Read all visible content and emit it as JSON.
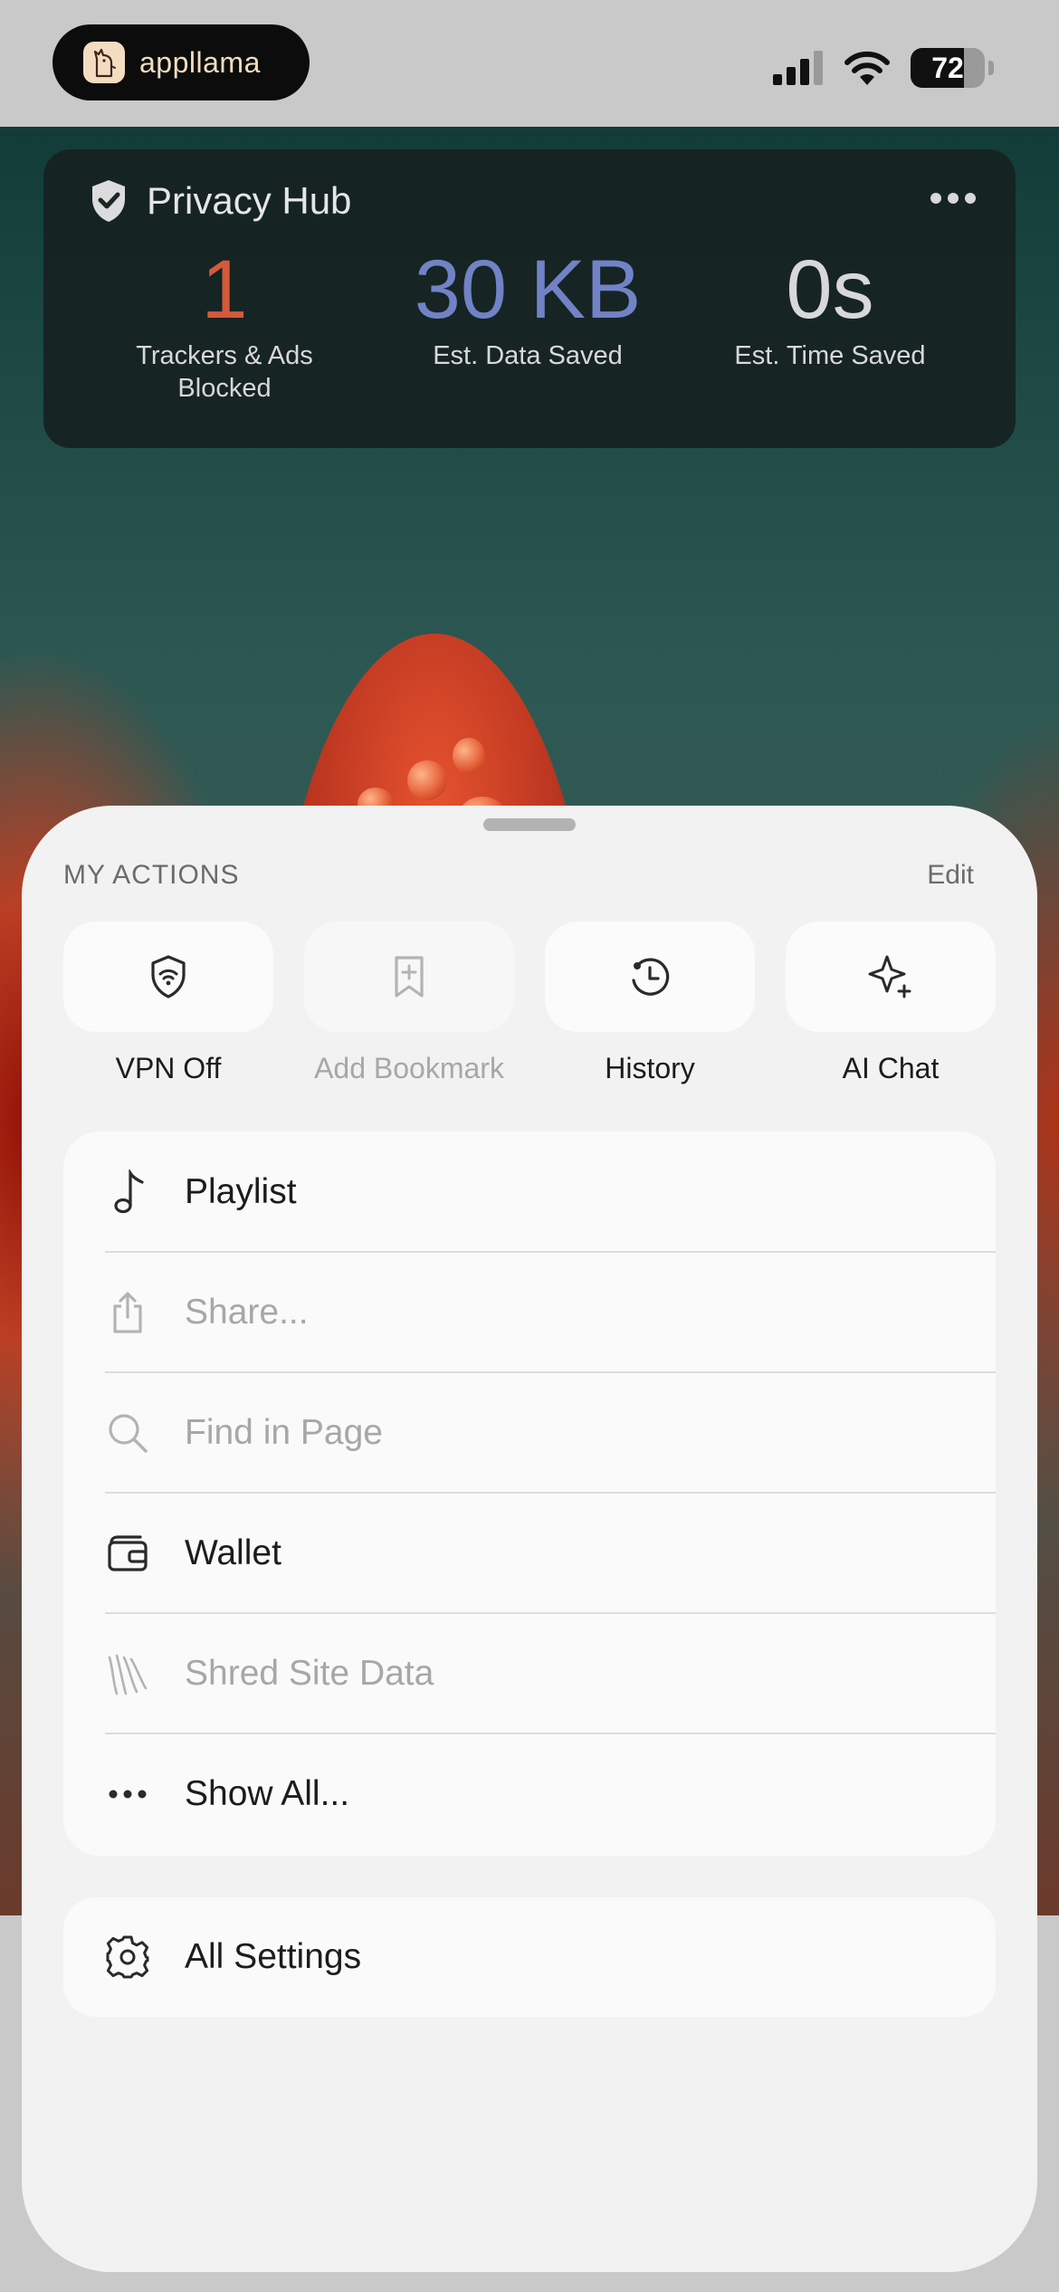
{
  "status_bar": {
    "app_name": "appllama",
    "battery": "72",
    "battery_level": 0.72,
    "icons": [
      "cellular-signal-icon",
      "wifi-icon",
      "battery-icon"
    ]
  },
  "privacy_hub": {
    "title": "Privacy Hub",
    "icon": "shield-check-icon",
    "stats": [
      {
        "value": "1",
        "label": "Trackers & Ads Blocked",
        "color": "#d35a3a"
      },
      {
        "value": "30 KB",
        "label": "Est. Data Saved",
        "color": "#7182c6"
      },
      {
        "value": "0s",
        "label": "Est. Time Saved",
        "color": "#d8d8d8"
      }
    ]
  },
  "sheet": {
    "section_title": "MY ACTIONS",
    "edit_label": "Edit",
    "quick_actions": [
      {
        "label": "VPN Off",
        "icon": "vpn-shield-icon",
        "enabled": true
      },
      {
        "label": "Add Bookmark",
        "icon": "add-bookmark-icon",
        "enabled": false
      },
      {
        "label": "History",
        "icon": "history-icon",
        "enabled": true
      },
      {
        "label": "AI Chat",
        "icon": "sparkle-icon",
        "enabled": true
      }
    ],
    "menu_items": [
      {
        "label": "Playlist",
        "icon": "music-note-icon",
        "enabled": true
      },
      {
        "label": "Share...",
        "icon": "share-icon",
        "enabled": false
      },
      {
        "label": "Find in Page",
        "icon": "search-icon",
        "enabled": false
      },
      {
        "label": "Wallet",
        "icon": "wallet-icon",
        "enabled": true
      },
      {
        "label": "Shred Site Data",
        "icon": "shred-icon",
        "enabled": false
      },
      {
        "label": "Show All...",
        "icon": "more-dots-icon",
        "enabled": true
      }
    ],
    "settings": {
      "label": "All Settings",
      "icon": "gear-icon"
    }
  }
}
